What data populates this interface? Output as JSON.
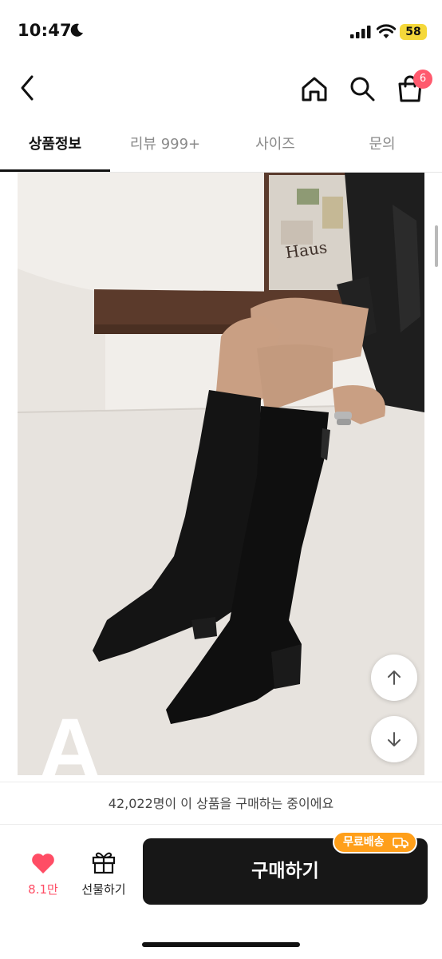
{
  "status_bar": {
    "time": "10:47",
    "battery": "58"
  },
  "header": {
    "cart_count": "6"
  },
  "tabs": [
    {
      "label": "상품정보"
    },
    {
      "label": "리뷰 999+"
    },
    {
      "label": "사이즈"
    },
    {
      "label": "문의"
    }
  ],
  "image_overlay": {
    "letter": "A",
    "sign_text": "Haus"
  },
  "info_bar": {
    "text": "42,022명이 이 상품을 구매하는 중이에요"
  },
  "actions": {
    "like_count": "8.1만",
    "gift_label": "선물하기",
    "buy_label": "구매하기",
    "free_shipping_badge": "무료배송"
  },
  "colors": {
    "accent": "#ff5a6e",
    "badge_orange": "#ff9f1a",
    "buy_button": "#171717"
  }
}
